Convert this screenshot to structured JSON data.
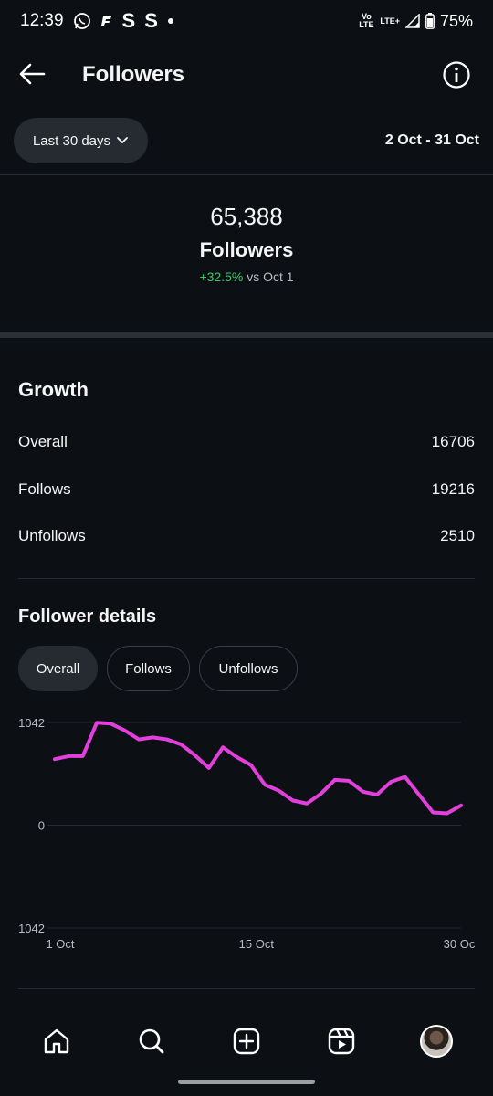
{
  "status_bar": {
    "time": "12:39",
    "left_icons": [
      "whatsapp-icon",
      "app-f-icon",
      "s-icon",
      "s-icon",
      "dot-icon"
    ],
    "volte_label": "Vo LTE",
    "network_label": "LTE+",
    "battery": "75%"
  },
  "header": {
    "title": "Followers"
  },
  "filter": {
    "range_label": "Last 30 days",
    "date_range": "2 Oct - 31 Oct"
  },
  "summary": {
    "count": "65,388",
    "label": "Followers",
    "change": "+32.5%",
    "change_suffix": "vs Oct 1",
    "change_color": "#3cc867"
  },
  "growth": {
    "title": "Growth",
    "rows": [
      {
        "label": "Overall",
        "value": "16706"
      },
      {
        "label": "Follows",
        "value": "19216"
      },
      {
        "label": "Unfollows",
        "value": "2510"
      }
    ]
  },
  "details": {
    "title": "Follower details",
    "tabs": [
      {
        "label": "Overall",
        "active": true
      },
      {
        "label": "Follows",
        "active": false
      },
      {
        "label": "Unfollows",
        "active": false
      }
    ]
  },
  "chart_data": {
    "type": "line",
    "series_color": "#e23fdc",
    "y_tick_labels": [
      "1042",
      "0",
      "1042"
    ],
    "x_tick_labels": [
      "1 Oct",
      "15 Oct",
      "30 Oc"
    ],
    "ylim": [
      -1042,
      1042
    ],
    "x": [
      1,
      2,
      3,
      4,
      5,
      6,
      7,
      8,
      9,
      10,
      11,
      12,
      13,
      14,
      15,
      16,
      17,
      18,
      19,
      20,
      21,
      22,
      23,
      24,
      25,
      26,
      27,
      28,
      29,
      30
    ],
    "values": [
      670,
      700,
      700,
      1040,
      1030,
      960,
      870,
      890,
      870,
      820,
      710,
      580,
      790,
      690,
      610,
      410,
      350,
      250,
      220,
      320,
      460,
      450,
      340,
      310,
      440,
      490,
      310,
      130,
      120,
      200
    ]
  },
  "bottom_nav": {
    "items": [
      "home-icon",
      "search-icon",
      "create-icon",
      "reels-icon",
      "profile-avatar"
    ]
  }
}
